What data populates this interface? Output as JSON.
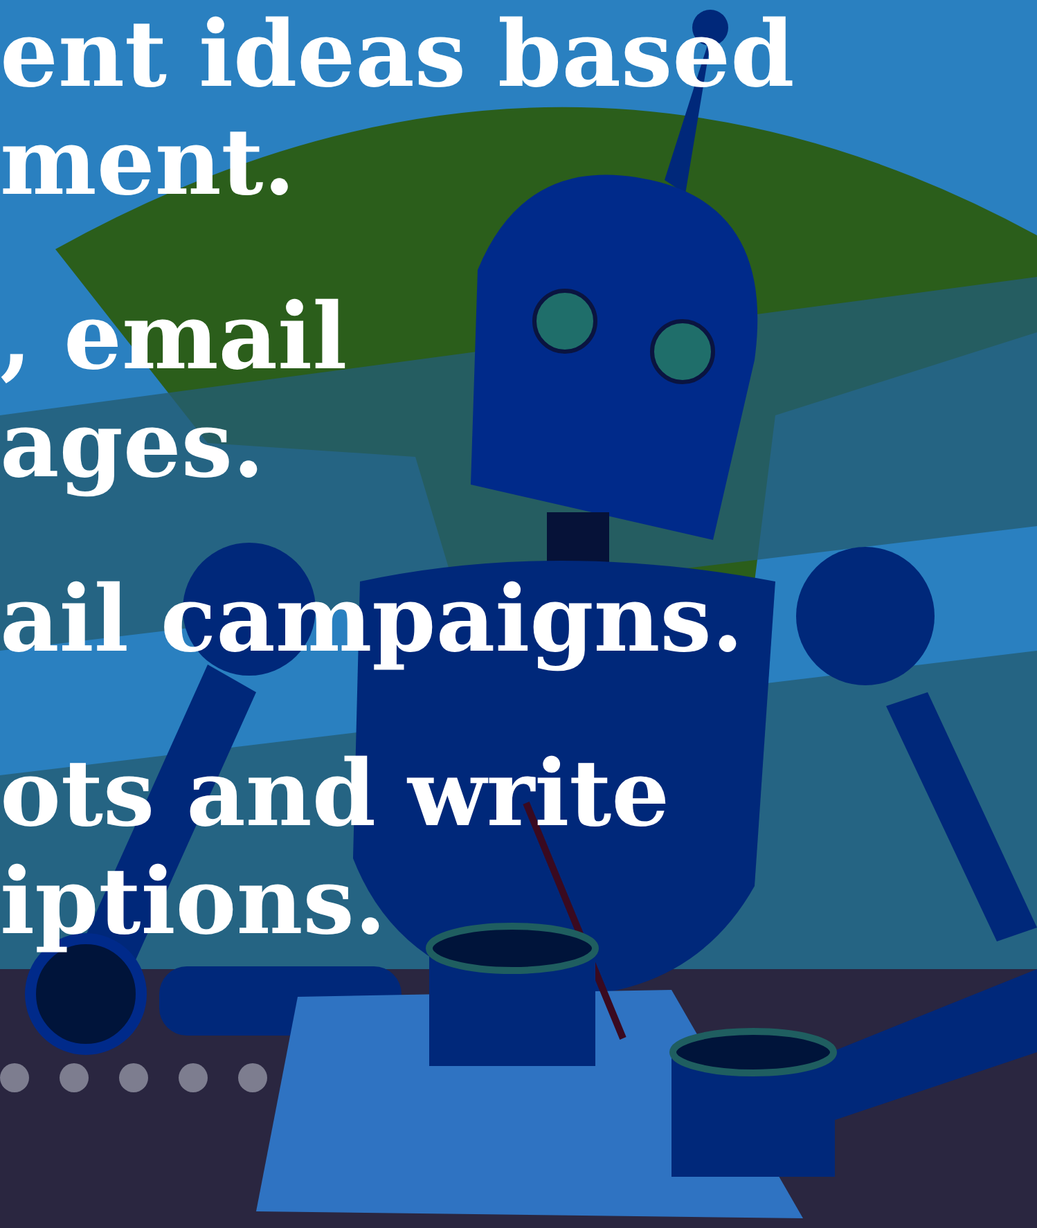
{
  "slide": {
    "paragraphs": [
      {
        "lines": [
          "ent ideas based",
          "ment."
        ]
      },
      {
        "lines": [
          ", email",
          "ages."
        ]
      },
      {
        "lines": [
          "ail campaigns."
        ]
      },
      {
        "lines": [
          "ots and write",
          "iptions."
        ]
      }
    ]
  },
  "carousel_dots": [
    {
      "selected": false
    },
    {
      "selected": false
    },
    {
      "selected": false
    },
    {
      "selected": false
    },
    {
      "selected": false
    }
  ]
}
